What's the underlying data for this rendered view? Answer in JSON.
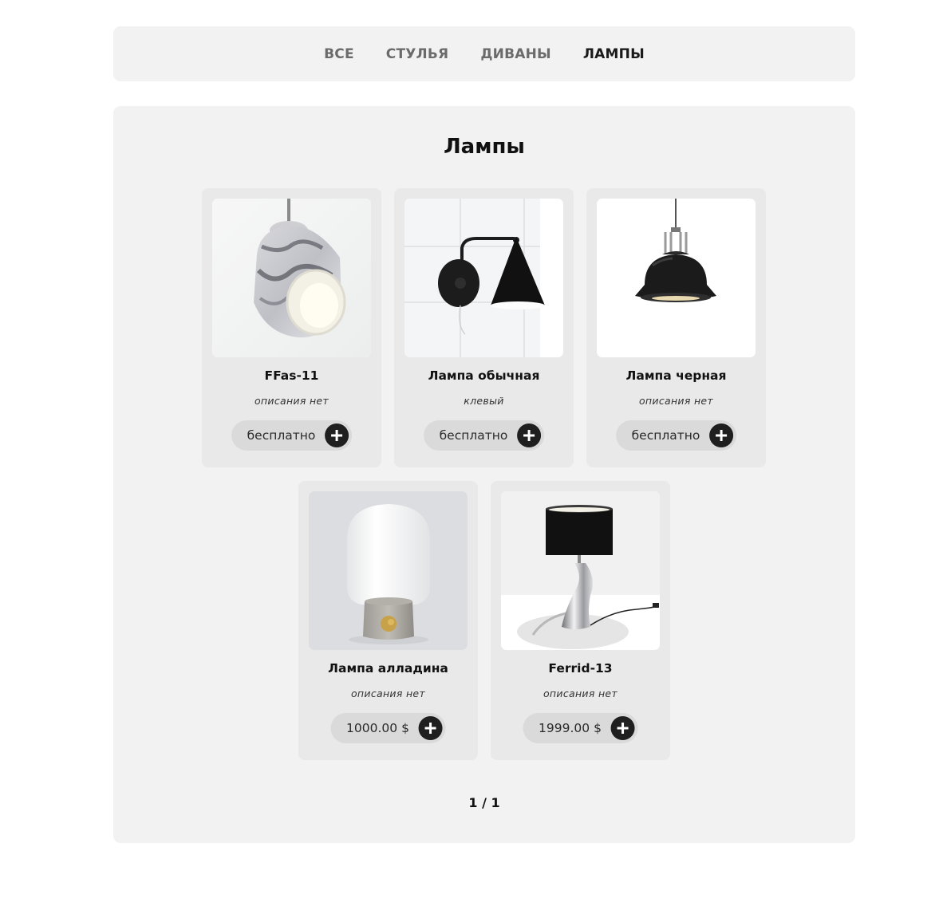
{
  "nav": {
    "items": [
      {
        "label": "ВСЕ",
        "active": false
      },
      {
        "label": "СТУЛЬЯ",
        "active": false
      },
      {
        "label": "ДИВАНЫ",
        "active": false
      },
      {
        "label": "ЛАМПЫ",
        "active": true
      }
    ]
  },
  "catalog": {
    "title": "Лампы",
    "products": [
      {
        "name": "FFas-11",
        "description": "описания нет",
        "price": "бесплатно",
        "image_icon": "marble-pendant-lamp-icon"
      },
      {
        "name": "Лампа обычная",
        "description": "клевый",
        "price": "бесплатно",
        "image_icon": "wall-sconce-lamp-icon"
      },
      {
        "name": "Лампа черная",
        "description": "описания нет",
        "price": "бесплатно",
        "image_icon": "black-pendant-lamp-icon"
      },
      {
        "name": "Лампа алладина",
        "description": "описания нет",
        "price": "1000.00 $",
        "image_icon": "white-globe-table-lamp-icon"
      },
      {
        "name": "Ferrid-13",
        "description": "описания нет",
        "price": "1999.00 $",
        "image_icon": "black-shade-table-lamp-icon"
      }
    ],
    "pagination": "1 / 1"
  },
  "colors": {
    "panel_bg": "#f2f2f2",
    "card_bg": "#e9e9e9",
    "pill_bg": "#dadada",
    "button_bg": "#1f1f1f",
    "nav_inactive": "#6b6b6b",
    "nav_active": "#1a1a1a"
  }
}
